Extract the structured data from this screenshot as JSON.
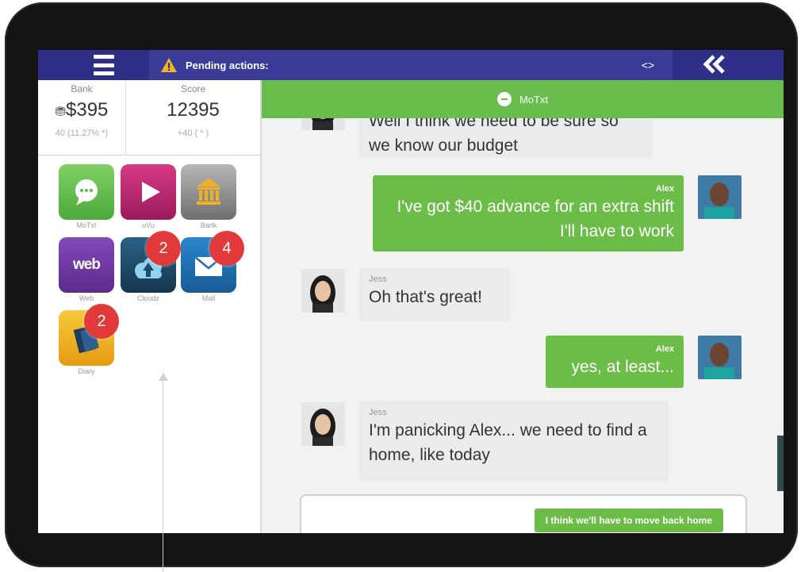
{
  "topbar": {
    "pending_label": "Pending actions:",
    "pending_toggle": "<>",
    "collapse_glyph": "«"
  },
  "stats": {
    "bank": {
      "label": "Bank",
      "value": "$395",
      "change": "40 (11.27% *)"
    },
    "score": {
      "label": "Score",
      "value": "12395",
      "change": "+40 ( * )"
    }
  },
  "apps": [
    {
      "label": "MoTxt",
      "icon": "chat-bubble-icon",
      "color": "#5cb847"
    },
    {
      "label": "uVu",
      "icon": "play-icon",
      "color": "#c0266f"
    },
    {
      "label": "Bank",
      "icon": "bank-building-icon",
      "color": "#8c8c8c"
    },
    {
      "label": "Web",
      "icon": "web-icon",
      "color": "#6a3a9e",
      "text": "web"
    },
    {
      "label": "Cloudz",
      "icon": "cloud-upload-icon",
      "color": "#1e4b6b",
      "badge": "2"
    },
    {
      "label": "Mail",
      "icon": "envelope-icon",
      "color": "#1f6fb3",
      "badge": "4"
    },
    {
      "label": "Diary",
      "icon": "diary-icon",
      "color": "#f2b21c",
      "badge": "2"
    }
  ],
  "chat": {
    "header_title": "MoTxt",
    "messages": [
      {
        "side": "in",
        "sender": "",
        "text": "Well I think we need to be sure so we know our budget"
      },
      {
        "side": "out",
        "sender": "Alex",
        "text": "I've got $40 advance for an extra shift I'll have to work"
      },
      {
        "side": "in",
        "sender": "Jess",
        "text": "Oh that's great!"
      },
      {
        "side": "out",
        "sender": "Alex",
        "text": "yes, at least..."
      },
      {
        "side": "in",
        "sender": "Jess",
        "text": "I'm panicking Alex... we need to find a home, like today"
      }
    ],
    "reply_option": "I think we'll have to move back home"
  },
  "colors": {
    "topbar": "#2e2f86",
    "chat_green": "#69bd4c",
    "badge_red": "#e23a3a"
  }
}
